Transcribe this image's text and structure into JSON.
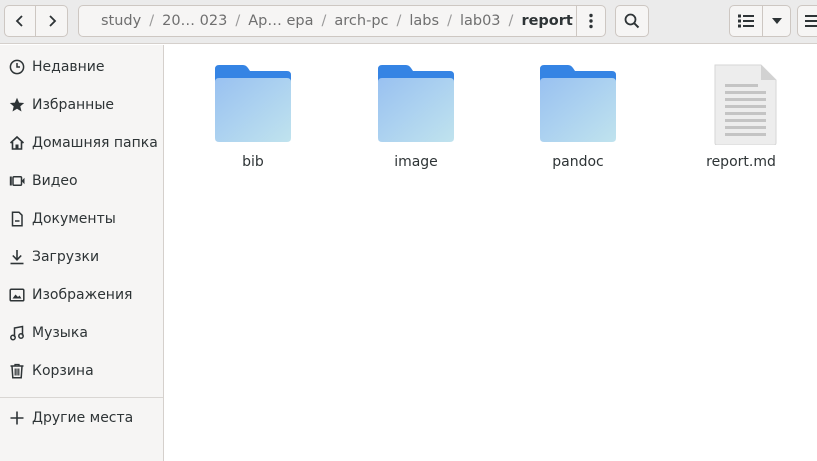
{
  "header": {
    "back_icon": "go-previous-icon",
    "forward_icon": "go-next-icon",
    "breadcrumbs": [
      "study",
      "20… 023",
      "Ар… ера",
      "arch-pc",
      "labs",
      "lab03",
      "report"
    ],
    "separator": "/",
    "menu_icon": "view-more-icon",
    "search_icon": "search-icon",
    "view_icon": "list-view-icon",
    "view_drop_icon": "chevron-down-icon",
    "main_menu_icon": "hamburger-menu-icon"
  },
  "sidebar": {
    "items": [
      {
        "label": "Недавние",
        "icon": "recent-icon"
      },
      {
        "label": "Избранные",
        "icon": "star-icon"
      },
      {
        "label": "Домашняя папка",
        "icon": "home-icon"
      },
      {
        "label": "Видео",
        "icon": "video-icon"
      },
      {
        "label": "Документы",
        "icon": "document-icon"
      },
      {
        "label": "Загрузки",
        "icon": "download-icon"
      },
      {
        "label": "Изображения",
        "icon": "image-icon"
      },
      {
        "label": "Музыка",
        "icon": "music-icon"
      },
      {
        "label": "Корзина",
        "icon": "trash-icon"
      }
    ],
    "other_locations": {
      "label": "Другие места",
      "icon": "plus-icon"
    }
  },
  "files": [
    {
      "name": "bib",
      "type": "folder"
    },
    {
      "name": "image",
      "type": "folder"
    },
    {
      "name": "pandoc",
      "type": "folder"
    },
    {
      "name": "report.md",
      "type": "text-document"
    }
  ],
  "colors": {
    "folder_tab": "#3584e4",
    "folder_body_top": "#99c1f1",
    "folder_body_bottom": "#c0e3ee",
    "headerbar": "#ebebeb",
    "sidebar": "#f6f5f4"
  }
}
